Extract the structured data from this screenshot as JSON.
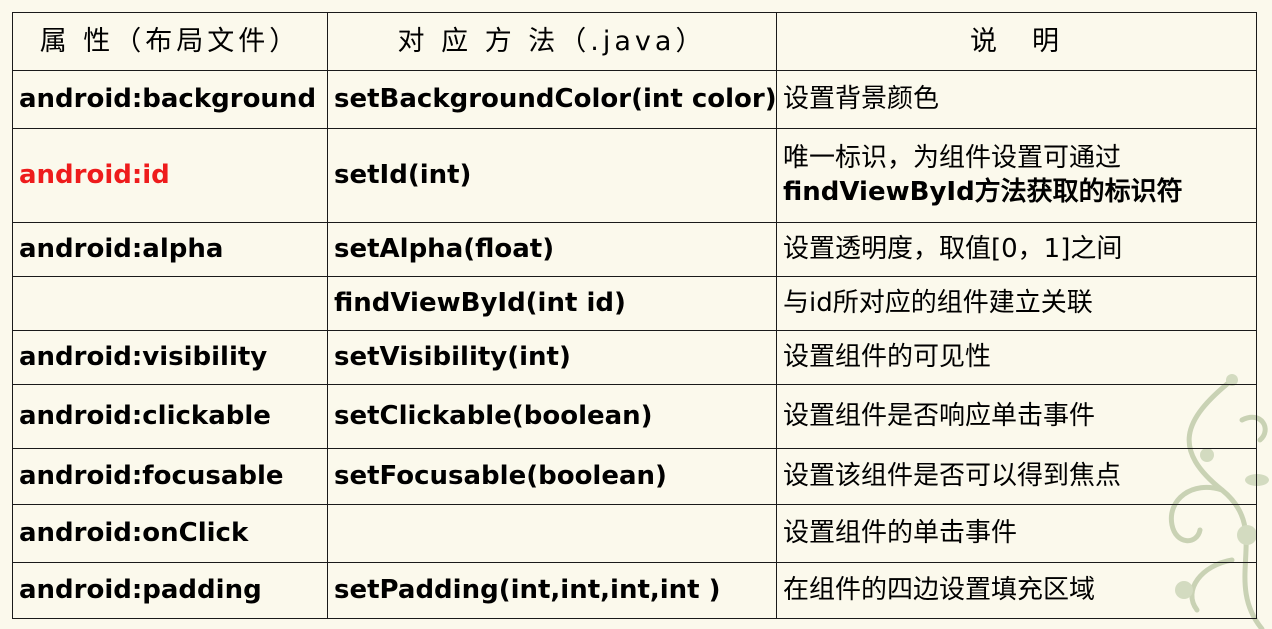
{
  "table": {
    "headers": [
      "属 性（布局文件）",
      "对 应 方 法（.java）",
      "说　明"
    ],
    "rows": [
      {
        "attribute": "android:background",
        "method": "setBackgroundColor(int color)",
        "description": [
          "设置背景颜色"
        ]
      },
      {
        "attribute": "android:id",
        "attribute_color": "#ee1c1c",
        "method": "setId(int)",
        "description": [
          "唯一标识，为组件设置可通过",
          "findViewById方法获取的标识符"
        ]
      },
      {
        "attribute": "android:alpha",
        "method": "setAlpha(float)",
        "description": [
          "设置透明度，取值[0，1]之间"
        ]
      },
      {
        "attribute": "",
        "method": "findViewById(int id)",
        "description": [
          "与id所对应的组件建立关联"
        ]
      },
      {
        "attribute": "android:visibility",
        "method": "setVisibility(int)",
        "description": [
          "设置组件的可见性"
        ]
      },
      {
        "attribute": "android:clickable",
        "method": "setClickable(boolean)",
        "description": [
          "设置组件是否响应单击事件"
        ]
      },
      {
        "attribute": "android:focusable",
        "method": "setFocusable(boolean)",
        "description": [
          "设置该组件是否可以得到焦点"
        ]
      },
      {
        "attribute": "android:onClick",
        "method": "",
        "description": [
          "设置组件的单击事件"
        ]
      },
      {
        "attribute": "android:padding",
        "method": "setPadding(int,int,int,int )",
        "description": [
          "在组件的四边设置填充区域"
        ]
      }
    ]
  },
  "colors": {
    "background": "#fbf9ec",
    "highlight": "#ee1c1c",
    "decoration": "#c9d2b4"
  },
  "icons": {
    "decoration": "floral-vine-decoration"
  }
}
